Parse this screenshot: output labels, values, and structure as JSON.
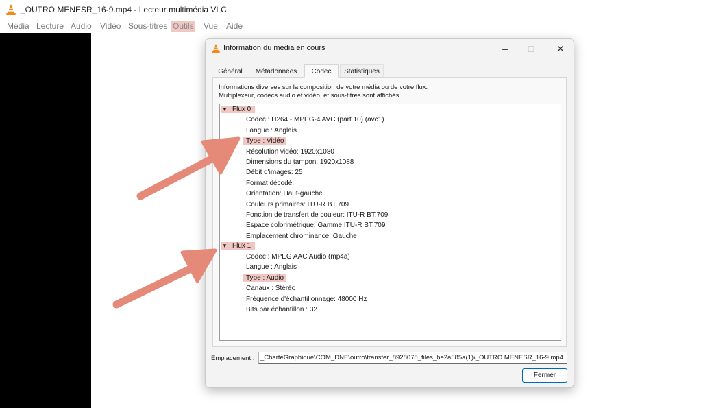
{
  "window": {
    "title": "_OUTRO MENESR_16-9.mp4 - Lecteur multimédia VLC",
    "icon": "vlc-cone-icon"
  },
  "menu": [
    {
      "label": "Média"
    },
    {
      "label": "Lecture"
    },
    {
      "label": "Audio"
    },
    {
      "label": "Vidéo"
    },
    {
      "label": "Sous-titres"
    },
    {
      "label": "Outils",
      "highlighted": true
    },
    {
      "label": "Vue"
    },
    {
      "label": "Aide"
    }
  ],
  "dialog": {
    "title": "Information du média en cours",
    "tabs": [
      {
        "label": "Général"
      },
      {
        "label": "Métadonnées"
      },
      {
        "label": "Codec",
        "active": true
      },
      {
        "label": "Statistiques"
      }
    ],
    "info_line_1": "Informations diverses sur la composition de votre média ou de votre flux.",
    "info_line_2": "Multiplexeur, codecs audio et vidéo, et sous-titres sont affichés.",
    "streams": [
      {
        "label": "Flux 0",
        "expanded": true,
        "items": [
          "Codec : H264 - MPEG-4 AVC (part 10) (avc1)",
          "Langue : Anglais",
          "Type : Vidéo",
          "Résolution vidéo: 1920x1080",
          "Dimensions du tampon: 1920x1088",
          "Débit d'images: 25",
          "Format décodé:",
          "Orientation: Haut-gauche",
          "Couleurs primaires: ITU-R BT.709",
          "Fonction de transfert de couleur: ITU-R BT.709",
          "Espace colorimétrique: Gamme ITU-R BT.709",
          "Emplacement chrominance: Gauche"
        ]
      },
      {
        "label": "Flux 1",
        "expanded": true,
        "items": [
          "Codec : MPEG AAC Audio (mp4a)",
          "Langue : Anglais",
          "Type : Audio",
          "Canaux : Stéréo",
          "Fréquence d'échantillonnage: 48000 Hz",
          "Bits par échantillon : 32"
        ]
      }
    ],
    "location_label": "Emplacement :",
    "location_value": "_CharteGraphique\\COM_DNE\\outro\\transfer_8928078_files_be2a585a(1)\\_OUTRO MENESR_16-9.mp4",
    "close_label": "Fermer"
  },
  "colors": {
    "highlight": "#f1c7c3",
    "arrow": "#e58a78",
    "accent": "#0067c0",
    "vlc_orange": "#f08a1d"
  }
}
